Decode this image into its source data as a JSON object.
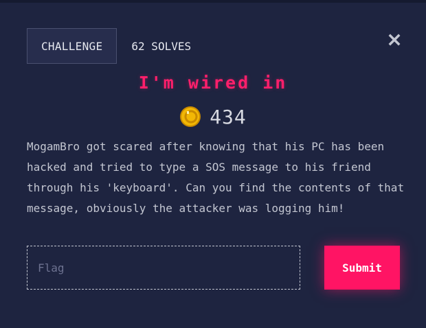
{
  "modal": {
    "tabs": [
      {
        "label": "CHALLENGE",
        "active": true
      },
      {
        "label": "62 SOLVES",
        "active": false
      }
    ],
    "close_icon": "close-icon",
    "title": "I'm wired in",
    "points": {
      "icon": "coin-icon",
      "value": "434"
    },
    "description": "MogamBro got scared after knowing that his PC has been hacked and tried to type a SOS message to his friend through his 'keyboard'. Can you find the contents of that message, obviously the attacker was logging him!",
    "flag_input": {
      "placeholder": "Flag",
      "value": ""
    },
    "submit_label": "Submit"
  },
  "colors": {
    "background": "#1e2440",
    "accent": "#ff1464",
    "title": "#ff1f6b",
    "coin": "#f2b705"
  }
}
